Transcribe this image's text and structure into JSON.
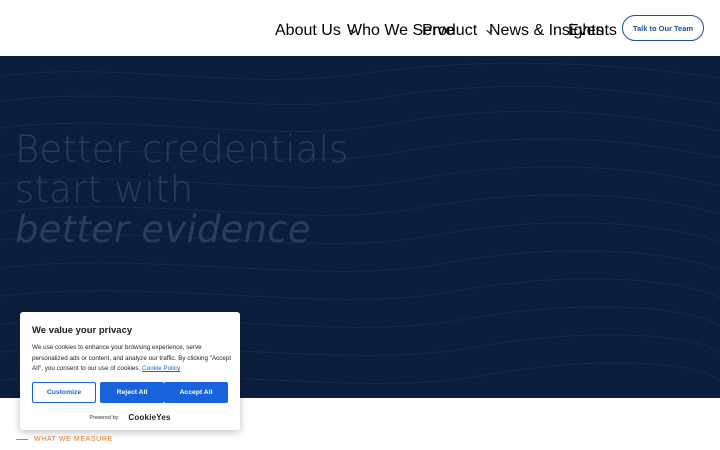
{
  "nav": {
    "items": [
      {
        "label": "About Us",
        "has_dropdown": true
      },
      {
        "label": "Who We Serve",
        "has_dropdown": false
      },
      {
        "label": "Product",
        "has_dropdown": true
      },
      {
        "label": "News & Insights",
        "has_dropdown": false
      },
      {
        "label": "Events",
        "has_dropdown": false
      }
    ],
    "cta_label": "Talk to Our Team"
  },
  "hero": {
    "line1": "Better credentials",
    "line2": "start with",
    "line3": "better evidence"
  },
  "section": {
    "eyebrow": "WHAT WE MEASURE"
  },
  "cookie_banner": {
    "title": "We value your privacy",
    "body": "We use cookies to enhance your browsing experience, serve personalized ads or content, and analyze our traffic. By clicking \"Accept All\", you consent to our use of cookies.",
    "policy_link": "Cookie Policy",
    "customize_label": "Customize",
    "reject_label": "Reject All",
    "accept_label": "Accept All",
    "powered_by": "Powered by",
    "brand": "CookieYes"
  },
  "colors": {
    "hero_bg": "#0b1f3d",
    "accent_orange": "#e07a2a",
    "cookie_blue": "#1863dc",
    "cta_blue": "#1d4f9a"
  }
}
